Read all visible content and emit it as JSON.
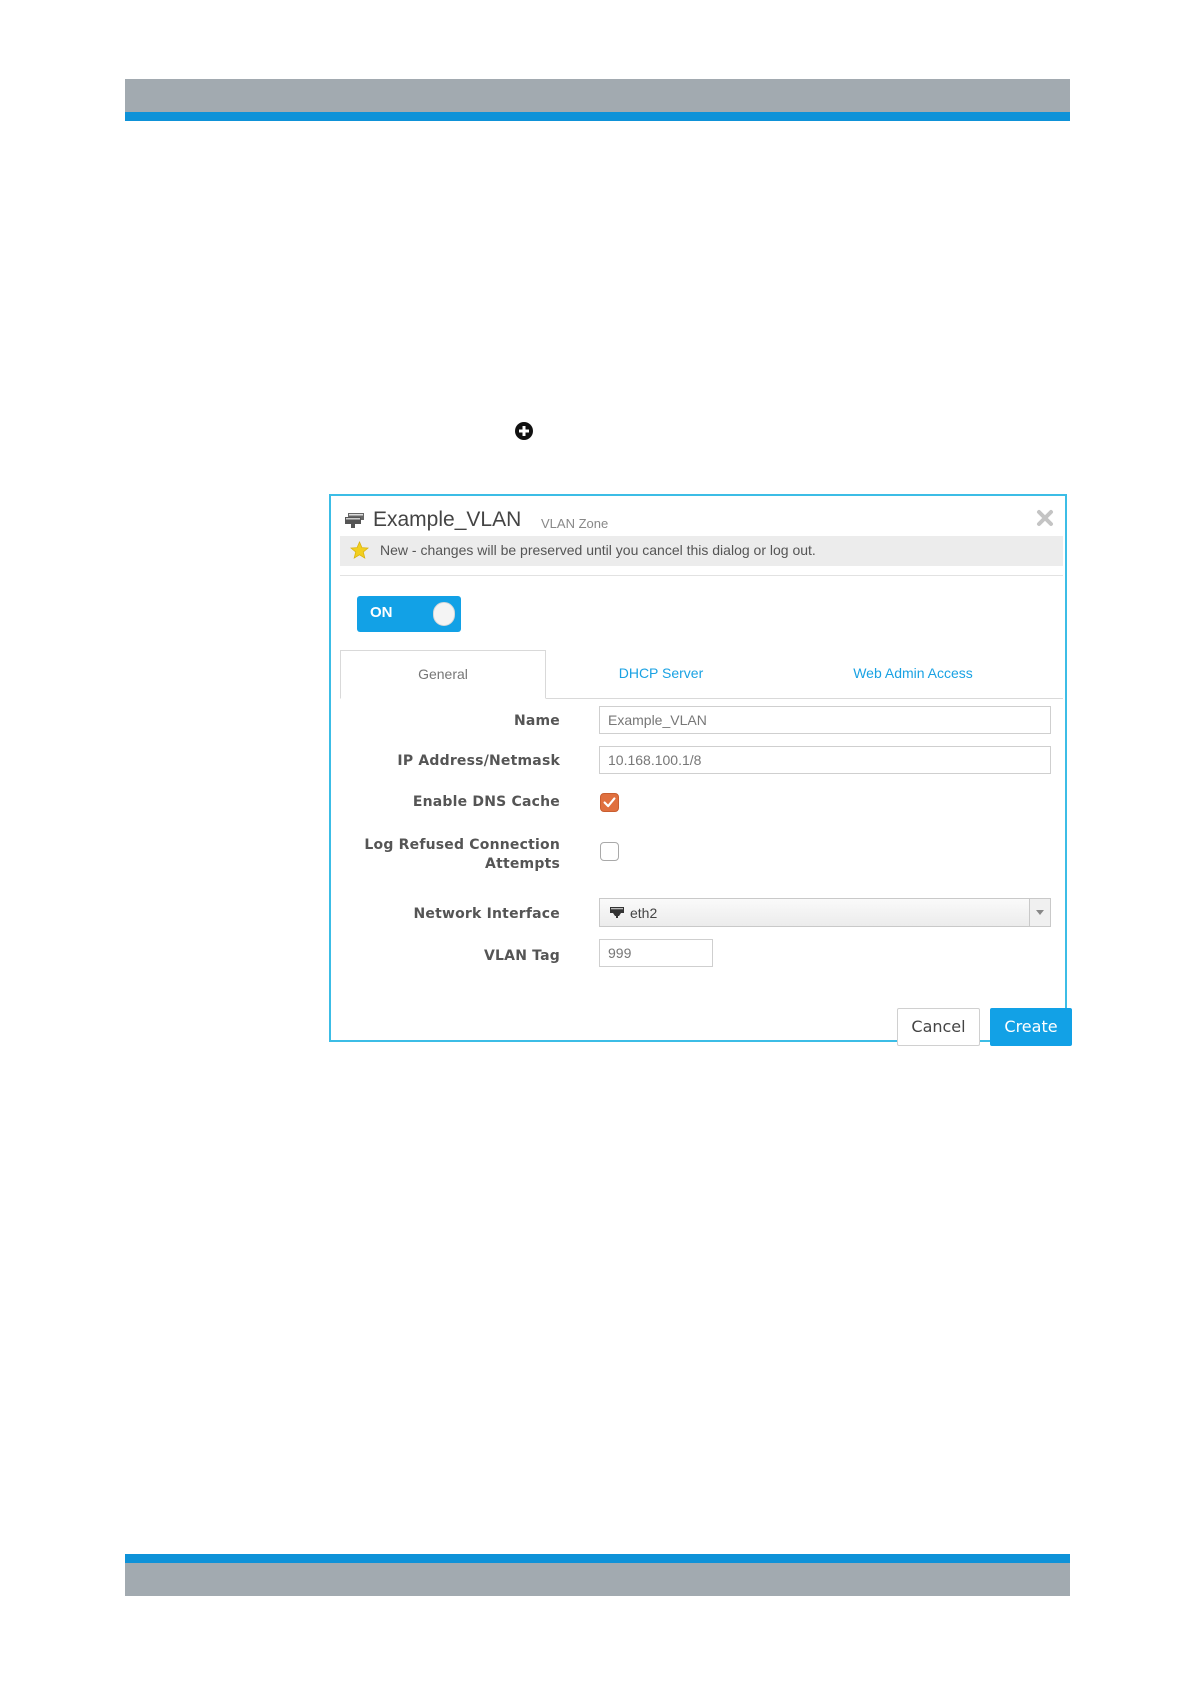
{
  "dialog": {
    "title": "Example_VLAN",
    "subtitle": "VLAN Zone",
    "notice": "New - changes will be preserved until you cancel this dialog or log out.",
    "toggle_label": "ON",
    "tabs": [
      {
        "label": "General",
        "active": true
      },
      {
        "label": "DHCP Server",
        "active": false
      },
      {
        "label": "Web Admin Access",
        "active": false
      }
    ],
    "fields": {
      "name": {
        "label": "Name",
        "value": "Example_VLAN"
      },
      "ip": {
        "label": "IP Address/Netmask",
        "value": "10.168.100.1/8"
      },
      "dns_cache": {
        "label": "Enable DNS Cache",
        "checked": true
      },
      "log_refused": {
        "label_line1": "Log Refused Connection",
        "label_line2": "Attempts",
        "checked": false
      },
      "network_interface": {
        "label": "Network Interface",
        "value": "eth2"
      },
      "vlan_tag": {
        "label": "VLAN Tag",
        "value": "999"
      }
    },
    "buttons": {
      "cancel": "Cancel",
      "create": "Create"
    }
  },
  "colors": {
    "accent": "#12a1e6",
    "band_blue": "#0e92d8",
    "band_grey": "#a2aab0",
    "checkbox_checked": "#e0703f"
  },
  "icons": [
    "circle-plus-icon",
    "network-zone-icon",
    "close-icon",
    "star-icon",
    "network-interface-icon",
    "checkmark-icon",
    "dropdown-arrow-icon"
  ]
}
